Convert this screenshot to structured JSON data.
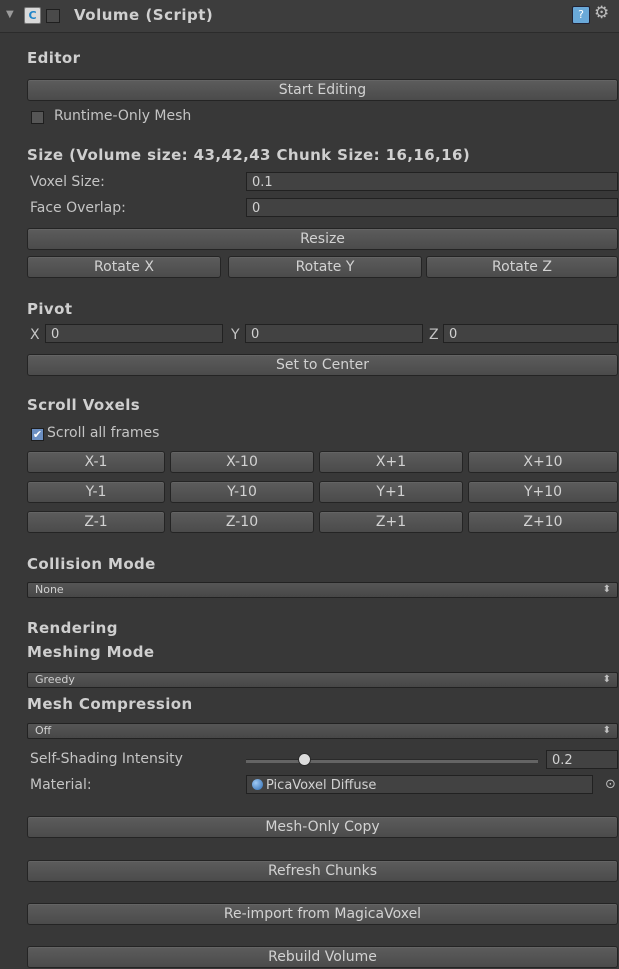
{
  "header": {
    "title": "Volume (Script)",
    "fold_glyph": "▼",
    "script_glyph": "C",
    "help_glyph": "?",
    "gear_glyph": "⚙"
  },
  "editor": {
    "heading": "Editor",
    "start_editing": "Start Editing",
    "runtime_only_mesh": "Runtime-Only Mesh",
    "runtime_only_mesh_checked": false
  },
  "size": {
    "heading": "Size (Volume size: 43,42,43 Chunk Size: 16,16,16)",
    "voxel_size_label": "Voxel Size:",
    "voxel_size_value": "0.1",
    "face_overlap_label": "Face Overlap:",
    "face_overlap_value": "0",
    "resize": "Resize",
    "rotate_x": "Rotate X",
    "rotate_y": "Rotate Y",
    "rotate_z": "Rotate Z"
  },
  "pivot": {
    "heading": "Pivot",
    "x_label": "X",
    "x_value": "0",
    "y_label": "Y",
    "y_value": "0",
    "z_label": "Z",
    "z_value": "0",
    "set_to_center": "Set to Center"
  },
  "scroll": {
    "heading": "Scroll Voxels",
    "all_frames": "Scroll all frames",
    "all_frames_checked": true,
    "check_glyph": "✔",
    "rows": [
      [
        "X-1",
        "X-10",
        "X+1",
        "X+10"
      ],
      [
        "Y-1",
        "Y-10",
        "Y+1",
        "Y+10"
      ],
      [
        "Z-1",
        "Z-10",
        "Z+1",
        "Z+10"
      ]
    ]
  },
  "collision": {
    "heading": "Collision Mode",
    "value": "None"
  },
  "rendering": {
    "heading": "Rendering",
    "meshing_heading": "Meshing Mode",
    "meshing_value": "Greedy",
    "compression_heading": "Mesh Compression",
    "compression_value": "Off",
    "self_shading_label": "Self-Shading Intensity",
    "self_shading_value": "0.2",
    "self_shading_fraction": 0.2,
    "material_label": "Material:",
    "material_value": "PicaVoxel Diffuse",
    "picker_glyph": "⊙",
    "dropdown_arrow": "⬍"
  },
  "actions": {
    "mesh_only_copy": "Mesh-Only Copy",
    "refresh_chunks": "Refresh Chunks",
    "reimport": "Re-import from MagicaVoxel",
    "rebuild_volume": "Rebuild Volume"
  },
  "colors": {
    "panel_bg": "#383838",
    "text": "#c4c4c4",
    "checkbox_checked": "#6b8fc2"
  }
}
